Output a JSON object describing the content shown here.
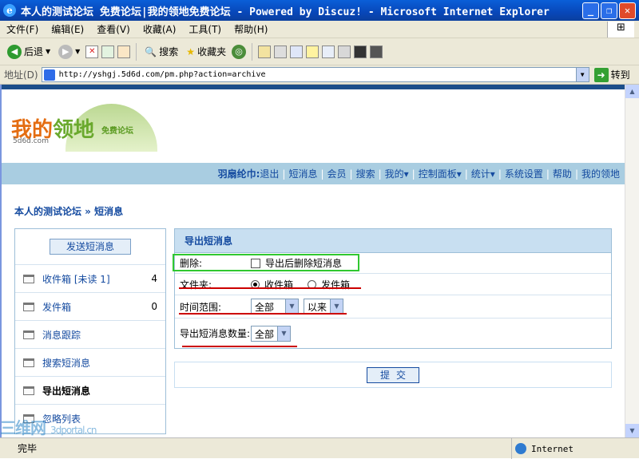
{
  "window": {
    "title": "本人的测试论坛 免费论坛|我的领地免费论坛 - Powered by Discuz! - Microsoft Internet Explorer",
    "icon": "ie-icon"
  },
  "menu": [
    "文件(F)",
    "编辑(E)",
    "查看(V)",
    "收藏(A)",
    "工具(T)",
    "帮助(H)"
  ],
  "toolbar": {
    "back": "后退",
    "search": "搜索",
    "favorites": "收藏夹"
  },
  "address": {
    "label": "地址(D)",
    "url": "http://yshgj.5d6d.com/pm.php?action=archive",
    "go": "转到"
  },
  "logo": {
    "main_a": "我的",
    "main_b": "领地",
    "sub": "免费论坛",
    "domain": "5d6d.com"
  },
  "nav": {
    "user": "羽扇纶巾:",
    "links": [
      "退出",
      "短消息",
      "会员",
      "搜索",
      "我的▾",
      "控制面板▾",
      "统计▾",
      "系统设置",
      "帮助",
      "我的领地"
    ]
  },
  "breadcrumb": "本人的测试论坛 » 短消息",
  "sidebar": {
    "send": "发送短消息",
    "items": [
      {
        "label": "收件箱 [未读 1]",
        "count": "4"
      },
      {
        "label": "发件箱",
        "count": "0"
      },
      {
        "label": "消息跟踪",
        "count": ""
      },
      {
        "label": "搜索短消息",
        "count": ""
      },
      {
        "label": "导出短消息",
        "count": ""
      },
      {
        "label": "忽略列表",
        "count": ""
      }
    ]
  },
  "panel": {
    "title": "导出短消息",
    "delete_label": "删除:",
    "delete_option": "导出后删除短消息",
    "folder_label": "文件夹:",
    "folder_inbox": "收件箱",
    "folder_outbox": "发件箱",
    "time_label": "时间范围:",
    "time_value": "全部",
    "time_dir": "以来",
    "amount_label": "导出短消息数量:",
    "amount_value": "全部",
    "submit": "提交"
  },
  "status": {
    "text": "完毕",
    "zone": "Internet"
  },
  "watermark": {
    "a": "三维网",
    "b": "3dportal.cn"
  },
  "colors": {
    "nav_bg": "#a9cde1",
    "link": "#154ba0",
    "highlight_green": "#30c830",
    "underline_red": "#c00000"
  }
}
